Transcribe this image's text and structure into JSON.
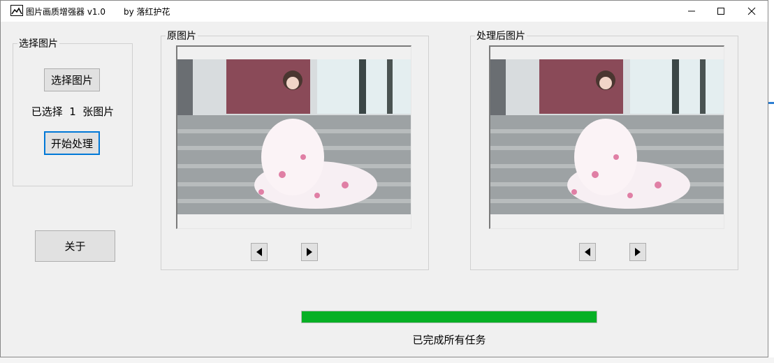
{
  "window": {
    "title": "图片画质增强器 v1.0",
    "author": "by 落红护花",
    "controls": {
      "minimize_icon": "minimize-icon",
      "maximize_icon": "maximize-icon",
      "close_icon": "close-icon"
    }
  },
  "select_group": {
    "legend": "选择图片",
    "select_button": "选择图片",
    "selected_text": "已选择  1  张图片",
    "start_button": "开始处理"
  },
  "about_button": "关于",
  "original_panel": {
    "legend": "原图片",
    "prev_icon": "triangle-left-icon",
    "next_icon": "triangle-right-icon"
  },
  "processed_panel": {
    "legend": "处理后图片",
    "prev_icon": "triangle-left-icon",
    "next_icon": "triangle-right-icon"
  },
  "progress": {
    "percent": 100,
    "color": "#06b025"
  },
  "status": "已完成所有任务",
  "colors": {
    "focus": "#0078d7",
    "window_bg": "#f0f0f0",
    "progress": "#06b025"
  }
}
